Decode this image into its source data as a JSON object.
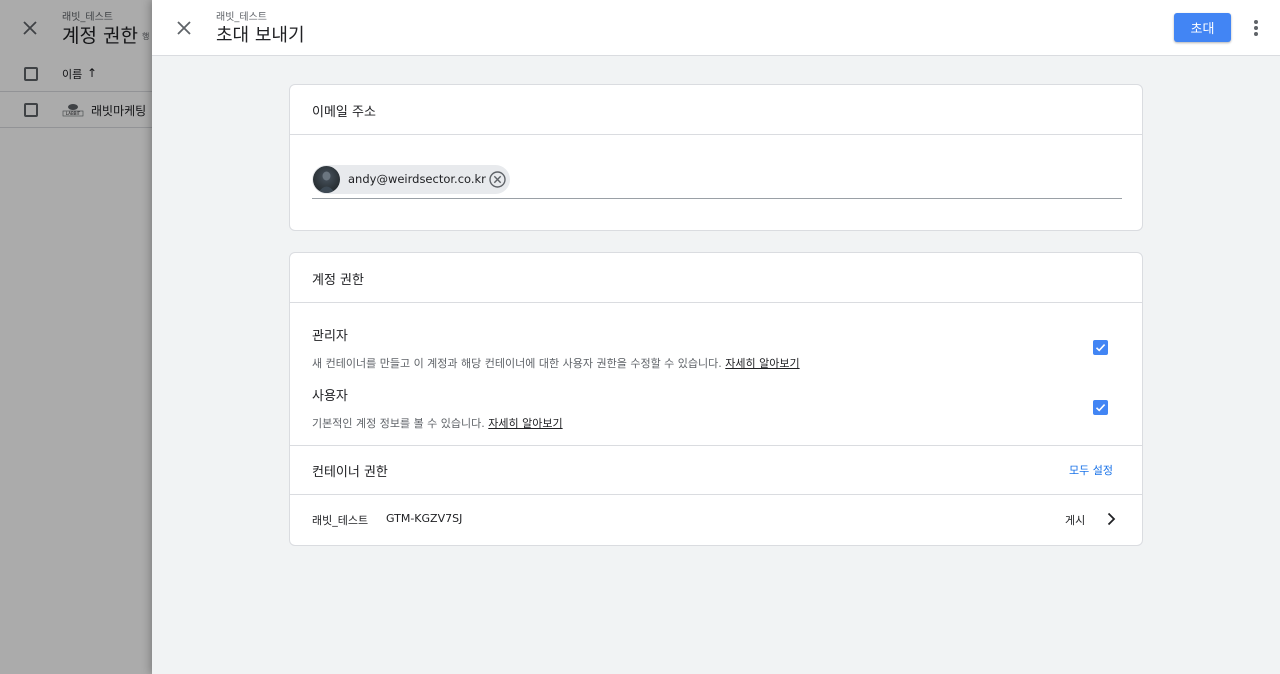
{
  "background": {
    "subtitle": "래빗_테스트",
    "title": "계정 권한",
    "title_extra": "행",
    "table": {
      "column_name": "이름",
      "rows": [
        {
          "name": "래빗마케팅",
          "logo_text": "LABBIT"
        }
      ]
    }
  },
  "drawer": {
    "subtitle": "래빗_테스트",
    "title": "초대 보내기",
    "invite_label": "초대"
  },
  "email_card": {
    "heading": "이메일 주소",
    "chips": [
      {
        "email": "andy@weirdsector.co.kr"
      }
    ]
  },
  "permission_card": {
    "heading": "계정 권한",
    "roles": [
      {
        "name": "관리자",
        "description": "새 컨테이너를 만들고 이 계정과 해당 컨테이너에 대한 사용자 권한을 수정할 수 있습니다.",
        "link": "자세히 알아보기",
        "checked": true
      },
      {
        "name": "사용자",
        "description": "기본적인 계정 정보를 볼 수 있습니다.",
        "link": "자세히 알아보기",
        "checked": true
      }
    ],
    "container_section": {
      "heading": "컨테이너 권한",
      "set_all_label": "모두 설정",
      "containers": [
        {
          "name": "래빗_테스트",
          "id": "GTM-KGZV7SJ",
          "permission": "게시"
        }
      ]
    }
  },
  "colors": {
    "primary": "#4285f4",
    "link": "#1a73e8",
    "drawer_bg": "#f1f3f4"
  }
}
